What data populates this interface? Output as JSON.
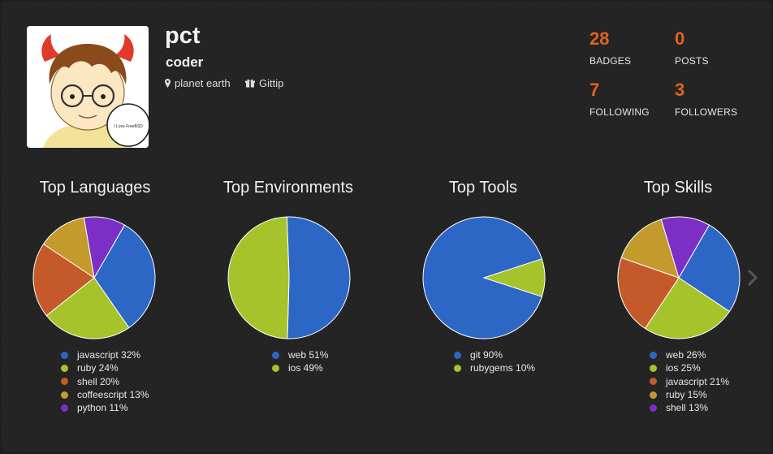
{
  "profile": {
    "name": "pct",
    "title": "coder",
    "location": "planet earth",
    "location_icon": "map-marker-icon",
    "gittip_label": "Gittip",
    "gittip_icon": "gift-icon",
    "avatar_caption": "I Love FreeBSD"
  },
  "stats": [
    {
      "value": "28",
      "label": "BADGES"
    },
    {
      "value": "0",
      "label": "POSTS"
    },
    {
      "value": "7",
      "label": "FOLLOWING"
    },
    {
      "value": "3",
      "label": "FOLLOWERS"
    }
  ],
  "colors": {
    "accent": "#e2621c",
    "blue": "#2d67c5",
    "green": "#a6c32c",
    "orange": "#c45a2a",
    "gold": "#c49a2c",
    "purple": "#7c2fc4"
  },
  "charts": [
    {
      "title": "Top Languages",
      "legend": [
        "javascript 32%",
        "ruby 24%",
        "shell 20%",
        "coffeescript 13%",
        "python 11%"
      ]
    },
    {
      "title": "Top Environments",
      "legend": [
        "web 51%",
        "ios 49%"
      ]
    },
    {
      "title": "Top Tools",
      "legend": [
        "git 90%",
        "rubygems 10%"
      ]
    },
    {
      "title": "Top Skills",
      "legend": [
        "web 26%",
        "ios 25%",
        "javascript 21%",
        "ruby 15%",
        "shell 13%"
      ]
    }
  ],
  "chart_data": [
    {
      "type": "pie",
      "title": "Top Languages",
      "categories": [
        "javascript",
        "ruby",
        "shell",
        "coffeescript",
        "python"
      ],
      "values": [
        32,
        24,
        20,
        13,
        11
      ],
      "colors": [
        "#2d67c5",
        "#a6c32c",
        "#c45a2a",
        "#c49a2c",
        "#7c2fc4"
      ],
      "start_angle_deg": -60
    },
    {
      "type": "pie",
      "title": "Top Environments",
      "categories": [
        "web",
        "ios"
      ],
      "values": [
        51,
        49
      ],
      "colors": [
        "#2d67c5",
        "#a6c32c"
      ],
      "start_angle_deg": -92
    },
    {
      "type": "pie",
      "title": "Top Tools",
      "categories": [
        "git",
        "rubygems"
      ],
      "values": [
        90,
        10
      ],
      "colors": [
        "#2d67c5",
        "#a6c32c"
      ],
      "start_angle_deg": 18
    },
    {
      "type": "pie",
      "title": "Top Skills",
      "categories": [
        "web",
        "ios",
        "javascript",
        "ruby",
        "shell"
      ],
      "values": [
        26,
        25,
        21,
        15,
        13
      ],
      "colors": [
        "#2d67c5",
        "#a6c32c",
        "#c45a2a",
        "#c49a2c",
        "#7c2fc4"
      ],
      "start_angle_deg": -60
    }
  ],
  "nav": {
    "next_icon": "chevron-right-icon"
  }
}
